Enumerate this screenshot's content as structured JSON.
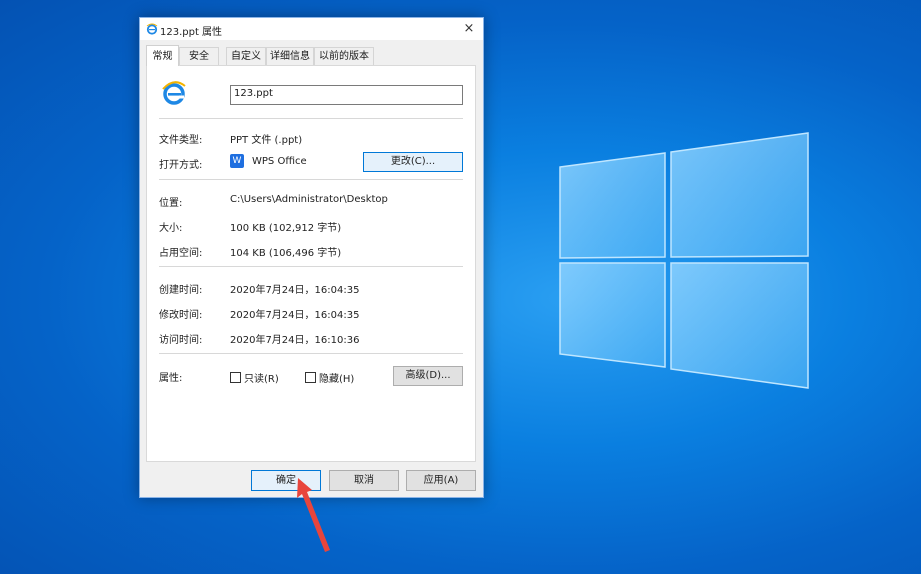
{
  "window": {
    "title": "123.ppt 属性",
    "close_label": "×"
  },
  "tabs": [
    {
      "label": "常规",
      "active": true
    },
    {
      "label": "安全"
    },
    {
      "label": "自定义"
    },
    {
      "label": "详细信息"
    },
    {
      "label": "以前的版本"
    }
  ],
  "general": {
    "file_name": "123.ppt",
    "file_type_label": "文件类型:",
    "file_type_value": "PPT 文件 (.ppt)",
    "opens_with_label": "打开方式:",
    "opens_with_value": "WPS Office",
    "change_button": "更改(C)...",
    "location_label": "位置:",
    "location_value": "C:\\Users\\Administrator\\Desktop",
    "size_label": "大小:",
    "size_value": "100 KB (102,912 字节)",
    "size_on_disk_label": "占用空间:",
    "size_on_disk_value": "104 KB (106,496 字节)",
    "created_label": "创建时间:",
    "created_value": "2020年7月24日，16:04:35",
    "modified_label": "修改时间:",
    "modified_value": "2020年7月24日，16:04:35",
    "accessed_label": "访问时间:",
    "accessed_value": "2020年7月24日，16:10:36",
    "attributes_label": "属性:",
    "readonly_label": "只读(R)",
    "hidden_label": "隐藏(H)",
    "advanced_button": "高级(D)..."
  },
  "footer": {
    "ok": "确定",
    "cancel": "取消",
    "apply": "应用(A)"
  },
  "colors": {
    "accent": "#0078d7",
    "arrow": "#e8453c",
    "desktop": "#0a7fe0"
  },
  "icons": {
    "title_icon": "internet-explorer-icon",
    "file_icon": "internet-explorer-icon",
    "app_icon": "wps-office-icon"
  }
}
